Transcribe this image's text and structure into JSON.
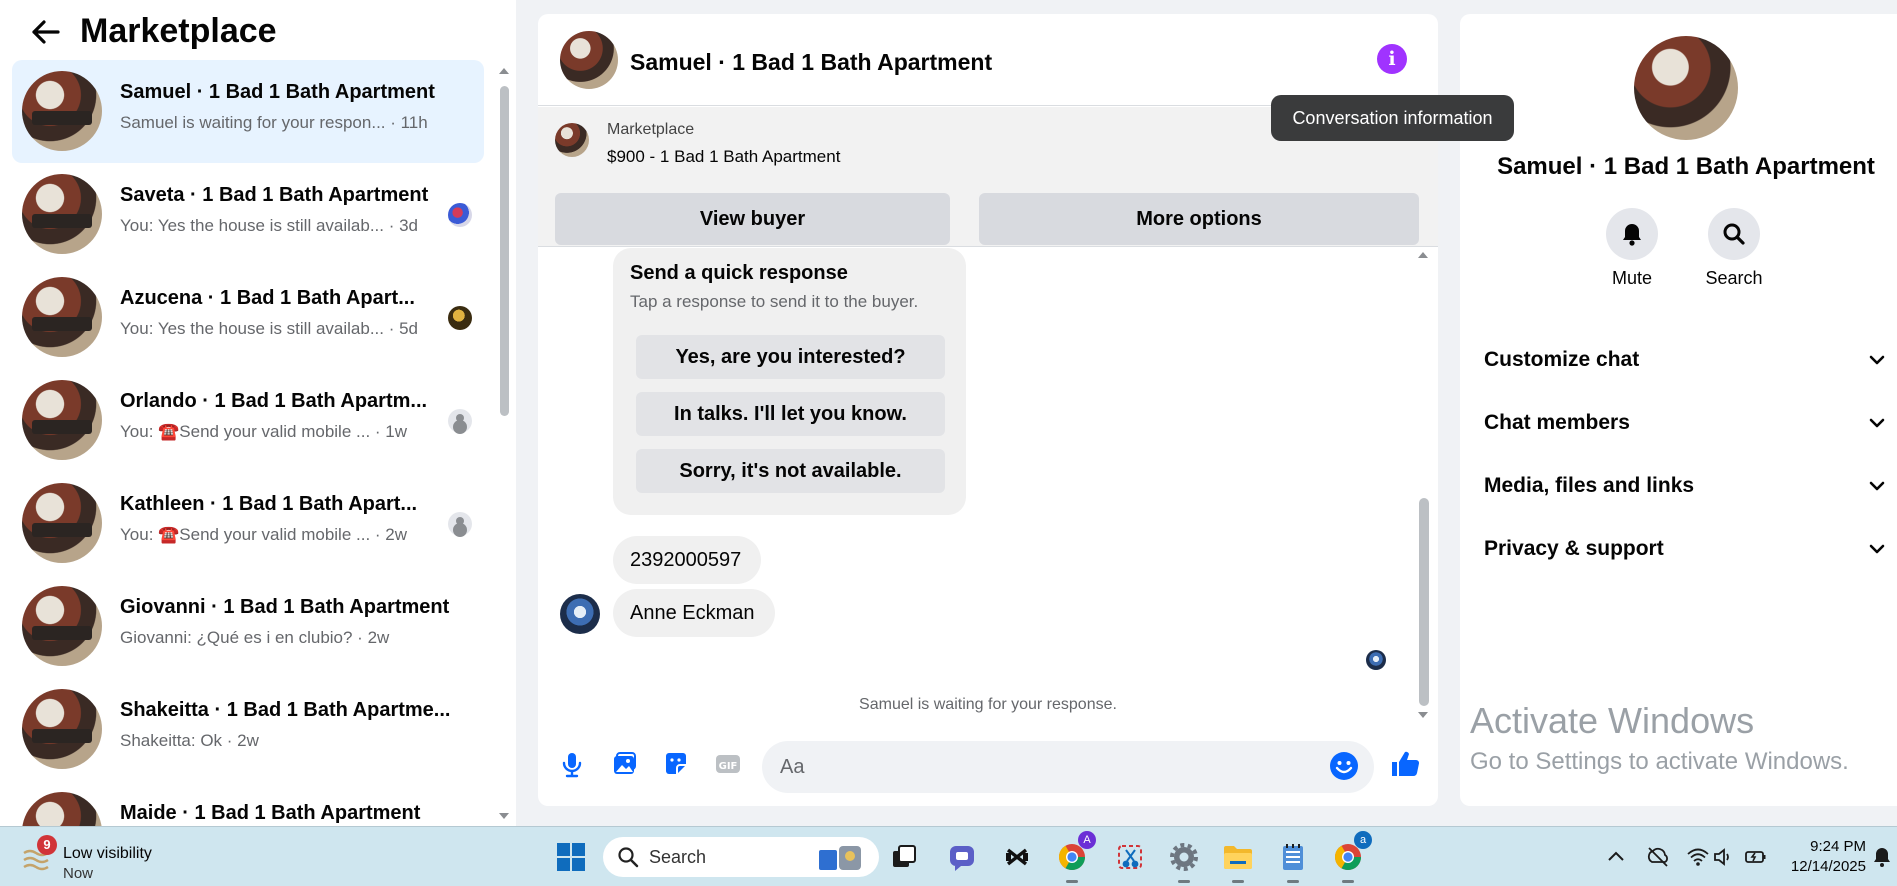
{
  "left_panel": {
    "title": "Marketplace",
    "conversations": [
      {
        "name": "Samuel · 1 Bad 1 Bath Apartment",
        "preview": "Samuel is waiting for your respon... · 11h",
        "active": true
      },
      {
        "name": "Saveta · 1 Bad 1 Bath Apartment",
        "preview": "You: Yes the house is still availab... · 3d"
      },
      {
        "name": "Azucena · 1 Bad 1 Bath Apart...",
        "preview": "You: Yes the house is still availab... · 5d"
      },
      {
        "name": "Orlando · 1 Bad 1 Bath Apartm...",
        "preview": "You: ☎️Send your valid mobile ... · 1w"
      },
      {
        "name": "Kathleen · 1 Bad 1 Bath Apart...",
        "preview": "You: ☎️Send your valid mobile ... · 2w"
      },
      {
        "name": "Giovanni · 1 Bad 1 Bath Apartment",
        "preview": "Giovanni: ¿Qué es i en clubio? · 2w"
      },
      {
        "name": "Shakeitta · 1 Bad 1 Bath Apartme...",
        "preview": "Shakeitta: Ok · 2w"
      },
      {
        "name": "Maide · 1 Bad 1 Bath Apartment",
        "preview": ""
      }
    ]
  },
  "chat": {
    "title": "Samuel · 1 Bad 1 Bath Apartment",
    "tooltip": "Conversation information",
    "marketplace_label": "Marketplace",
    "listing": "$900 - 1 Bad 1 Bath Apartment",
    "view_buyer": "View buyer",
    "more_options": "More options",
    "quick_response": {
      "title": "Send a quick response",
      "subtitle": "Tap a response to send it to the buyer.",
      "options": [
        "Yes, are you interested?",
        "In talks. I'll let you know.",
        "Sorry, it's not available."
      ]
    },
    "messages": [
      "2392000597",
      "Anne Eckman"
    ],
    "waiting": "Samuel is waiting for your response.",
    "input_placeholder": "Aa"
  },
  "info_panel": {
    "name": "Samuel · 1 Bad 1 Bath Apartment",
    "actions": {
      "mute": "Mute",
      "search": "Search"
    },
    "sections": [
      "Customize chat",
      "Chat members",
      "Media, files and links",
      "Privacy & support"
    ]
  },
  "watermark": {
    "line1": "Activate Windows",
    "line2": "Go to Settings to activate Windows."
  },
  "taskbar": {
    "weather_badge": "9",
    "weather_line1": "Low visibility",
    "weather_line2": "Now",
    "search_label": "Search",
    "chrome_badge": "A",
    "chrome2_badge": "a",
    "time": "9:24 PM",
    "date": "12/14/2025"
  },
  "colors": {
    "accent": "#0866ff",
    "info_purple": "#a033ff",
    "taskbar": "#cfe6ef"
  }
}
